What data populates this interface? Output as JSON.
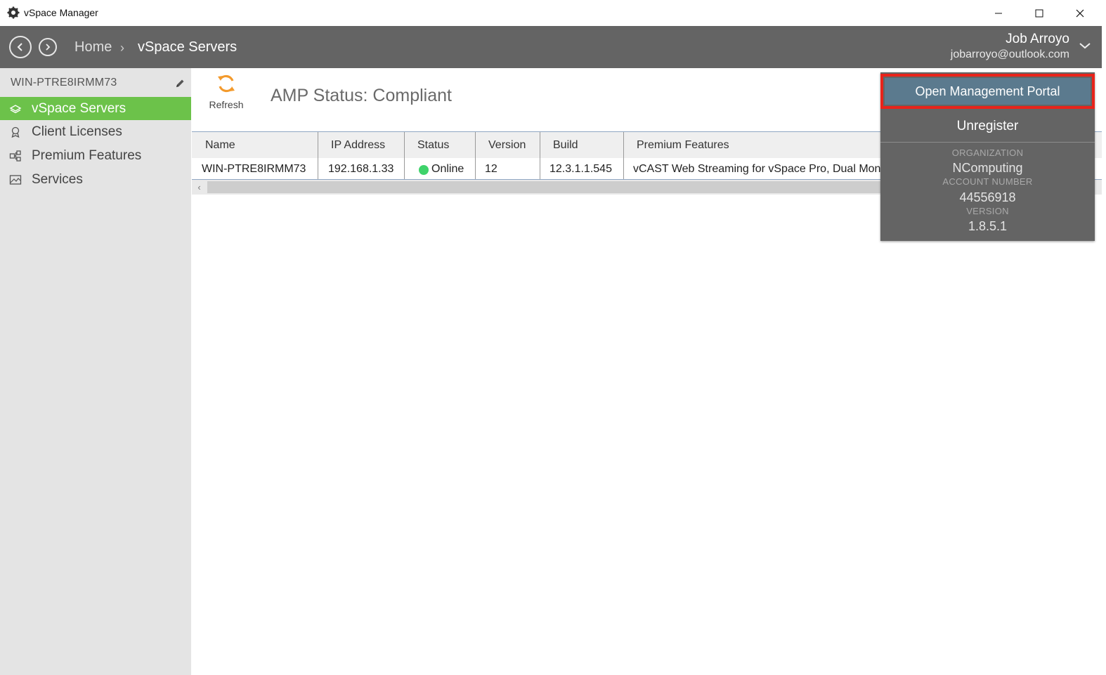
{
  "window": {
    "title": "vSpace Manager",
    "icon": "gear-icon",
    "controls": [
      "minimize-icon",
      "maximize-icon",
      "close-icon"
    ]
  },
  "header": {
    "breadcrumb": {
      "home": "Home",
      "separator": "›",
      "current": "vSpace Servers"
    },
    "user": {
      "name": "Job Arroyo",
      "email": "jobarroyo@outlook.com"
    }
  },
  "sidebar": {
    "machine_name": "WIN-PTRE8IRMM73",
    "items": [
      {
        "label": "vSpace Servers",
        "icon": "server-icon",
        "active": true
      },
      {
        "label": "Client Licenses",
        "icon": "license-icon",
        "active": false
      },
      {
        "label": "Premium Features",
        "icon": "features-icon",
        "active": false
      },
      {
        "label": "Services",
        "icon": "services-icon",
        "active": false
      }
    ]
  },
  "toolbar": {
    "refresh_label": "Refresh"
  },
  "amp_status": "AMP Status: Compliant",
  "table": {
    "columns": [
      "Name",
      "IP Address",
      "Status",
      "Version",
      "Build",
      "Premium Features"
    ],
    "rows": [
      {
        "name": "WIN-PTRE8IRMM73",
        "ip": "192.168.1.33",
        "status": "Online",
        "version": "12",
        "build": "12.3.1.1.545",
        "premium": "vCAST Web Streaming for vSpace Pro, Dual Monitor Support, Video Expansion Pack"
      }
    ]
  },
  "account_panel": {
    "portal_button": "Open Management Portal",
    "unregister": "Unregister",
    "organization_label": "ORGANIZATION",
    "organization": "NComputing",
    "account_label": "ACCOUNT NUMBER",
    "account_number": "44556918",
    "version_label": "VERSION",
    "version": "1.8.5.1"
  },
  "colors": {
    "header_bg": "#646464",
    "active_green": "#6cc24a",
    "online_green": "#3fd36b",
    "refresh_orange": "#f39a2c",
    "highlight_red": "#e8231a",
    "portal_button": "#5b7a8e"
  }
}
